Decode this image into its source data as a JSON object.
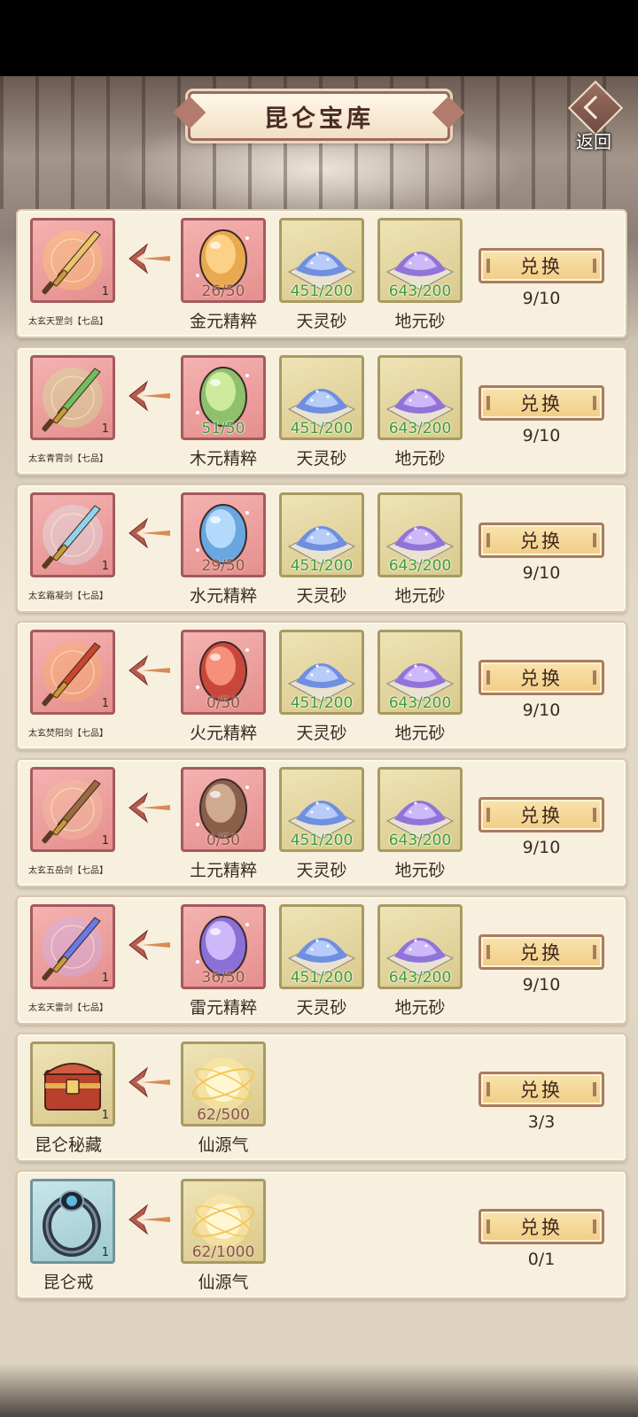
{
  "header": {
    "title": "昆仑宝库",
    "back_label": "返回"
  },
  "button_label": "兑换",
  "colors": {
    "count_ok": "#3f9b35",
    "count_low": "#8a5347",
    "accent": "#f0cd86"
  },
  "rows": [
    {
      "product": {
        "name": "太玄天罡剑【七品】",
        "qty": "1",
        "style": "pink",
        "icon": "golden-sword-icon"
      },
      "materials": [
        {
          "name": "金元精粹",
          "count": "26/50",
          "style": "pink",
          "icon": "gold-essence-stone-icon"
        },
        {
          "name": "天灵砂",
          "count": "451/200",
          "style": "gold",
          "icon": "blue-sand-icon"
        },
        {
          "name": "地元砂",
          "count": "643/200",
          "style": "gold",
          "icon": "purple-sand-icon"
        }
      ],
      "limit": "9/10"
    },
    {
      "product": {
        "name": "太玄青霄剑【七品】",
        "qty": "1",
        "style": "pink",
        "icon": "green-sword-icon"
      },
      "materials": [
        {
          "name": "木元精粹",
          "count": "51/50",
          "style": "pink",
          "icon": "wood-essence-stone-icon"
        },
        {
          "name": "天灵砂",
          "count": "451/200",
          "style": "gold",
          "icon": "blue-sand-icon"
        },
        {
          "name": "地元砂",
          "count": "643/200",
          "style": "gold",
          "icon": "purple-sand-icon"
        }
      ],
      "limit": "9/10"
    },
    {
      "product": {
        "name": "太玄霜凝剑【七品】",
        "qty": "1",
        "style": "pink",
        "icon": "ice-sword-icon"
      },
      "materials": [
        {
          "name": "水元精粹",
          "count": "29/50",
          "style": "pink",
          "icon": "water-essence-stone-icon"
        },
        {
          "name": "天灵砂",
          "count": "451/200",
          "style": "gold",
          "icon": "blue-sand-icon"
        },
        {
          "name": "地元砂",
          "count": "643/200",
          "style": "gold",
          "icon": "purple-sand-icon"
        }
      ],
      "limit": "9/10"
    },
    {
      "product": {
        "name": "太玄焚阳剑【七品】",
        "qty": "1",
        "style": "pink",
        "icon": "fire-sword-icon"
      },
      "materials": [
        {
          "name": "火元精粹",
          "count": "0/50",
          "style": "pink",
          "icon": "fire-essence-stone-icon"
        },
        {
          "name": "天灵砂",
          "count": "451/200",
          "style": "gold",
          "icon": "blue-sand-icon"
        },
        {
          "name": "地元砂",
          "count": "643/200",
          "style": "gold",
          "icon": "purple-sand-icon"
        }
      ],
      "limit": "9/10"
    },
    {
      "product": {
        "name": "太玄五岳剑【七品】",
        "qty": "1",
        "style": "pink",
        "icon": "earth-sword-icon"
      },
      "materials": [
        {
          "name": "土元精粹",
          "count": "0/50",
          "style": "pink",
          "icon": "earth-essence-stone-icon"
        },
        {
          "name": "天灵砂",
          "count": "451/200",
          "style": "gold",
          "icon": "blue-sand-icon"
        },
        {
          "name": "地元砂",
          "count": "643/200",
          "style": "gold",
          "icon": "purple-sand-icon"
        }
      ],
      "limit": "9/10"
    },
    {
      "product": {
        "name": "太玄天雷剑【七品】",
        "qty": "1",
        "style": "pink",
        "icon": "thunder-sword-icon"
      },
      "materials": [
        {
          "name": "雷元精粹",
          "count": "36/50",
          "style": "pink",
          "icon": "thunder-essence-stone-icon"
        },
        {
          "name": "天灵砂",
          "count": "451/200",
          "style": "gold",
          "icon": "blue-sand-icon"
        },
        {
          "name": "地元砂",
          "count": "643/200",
          "style": "gold",
          "icon": "purple-sand-icon"
        }
      ],
      "limit": "9/10"
    },
    {
      "product": {
        "name": "昆仑秘藏",
        "qty": "1",
        "style": "gold",
        "icon": "treasure-chest-icon"
      },
      "materials": [
        {
          "name": "仙源气",
          "count": "62/500",
          "style": "gold",
          "icon": "immortal-qi-orb-icon"
        }
      ],
      "limit": "3/3"
    },
    {
      "product": {
        "name": "昆仑戒",
        "qty": "1",
        "style": "blue",
        "icon": "ring-icon"
      },
      "materials": [
        {
          "name": "仙源气",
          "count": "62/1000",
          "style": "gold",
          "icon": "immortal-qi-orb-icon"
        }
      ],
      "limit": "0/1"
    }
  ]
}
